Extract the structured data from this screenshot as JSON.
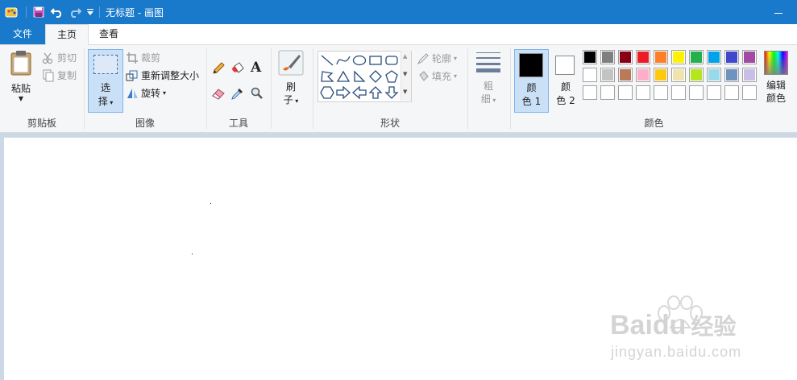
{
  "window": {
    "title": "无标题 - 画图",
    "minimize_icon": "minimize-icon"
  },
  "tabs": {
    "file": "文件",
    "home": "主页",
    "view": "查看"
  },
  "clipboard": {
    "paste": "粘贴",
    "cut": "剪切",
    "copy": "复制",
    "label": "剪贴板"
  },
  "image": {
    "select_line1": "选",
    "select_line2": "择",
    "crop": "裁剪",
    "resize": "重新调整大小",
    "rotate": "旋转",
    "label": "图像"
  },
  "tools": {
    "label": "工具"
  },
  "brush": {
    "line1": "刷",
    "line2": "子"
  },
  "shapes": {
    "outline": "轮廓",
    "fill": "填充",
    "label": "形状"
  },
  "size": {
    "line1": "粗",
    "line2": "细"
  },
  "colors": {
    "color1_line1": "颜",
    "color1_line2": "色 1",
    "color2_line1": "颜",
    "color2_line2": "色 2",
    "edit_line1": "编辑",
    "edit_line2": "颜色",
    "label": "颜色",
    "color1_value": "#000000",
    "color2_value": "#ffffff",
    "palette_row1": [
      "#000000",
      "#7f7f7f",
      "#880015",
      "#ed1c24",
      "#ff7f27",
      "#fff200",
      "#22b14c",
      "#00a2e8",
      "#3f48cc",
      "#a349a4"
    ],
    "palette_row2": [
      "#ffffff",
      "#c3c3c3",
      "#b97a57",
      "#ffaec9",
      "#ffc90e",
      "#efe4b0",
      "#b5e61d",
      "#99d9ea",
      "#7092be",
      "#c8bfe7"
    ],
    "palette_row3": [
      "#ffffff",
      "#ffffff",
      "#ffffff",
      "#ffffff",
      "#ffffff",
      "#ffffff",
      "#ffffff",
      "#ffffff",
      "#ffffff",
      "#ffffff"
    ]
  },
  "watermark": {
    "brand": "Baidu",
    "brand_cn": "经验",
    "url": "jingyan.baidu.com"
  }
}
